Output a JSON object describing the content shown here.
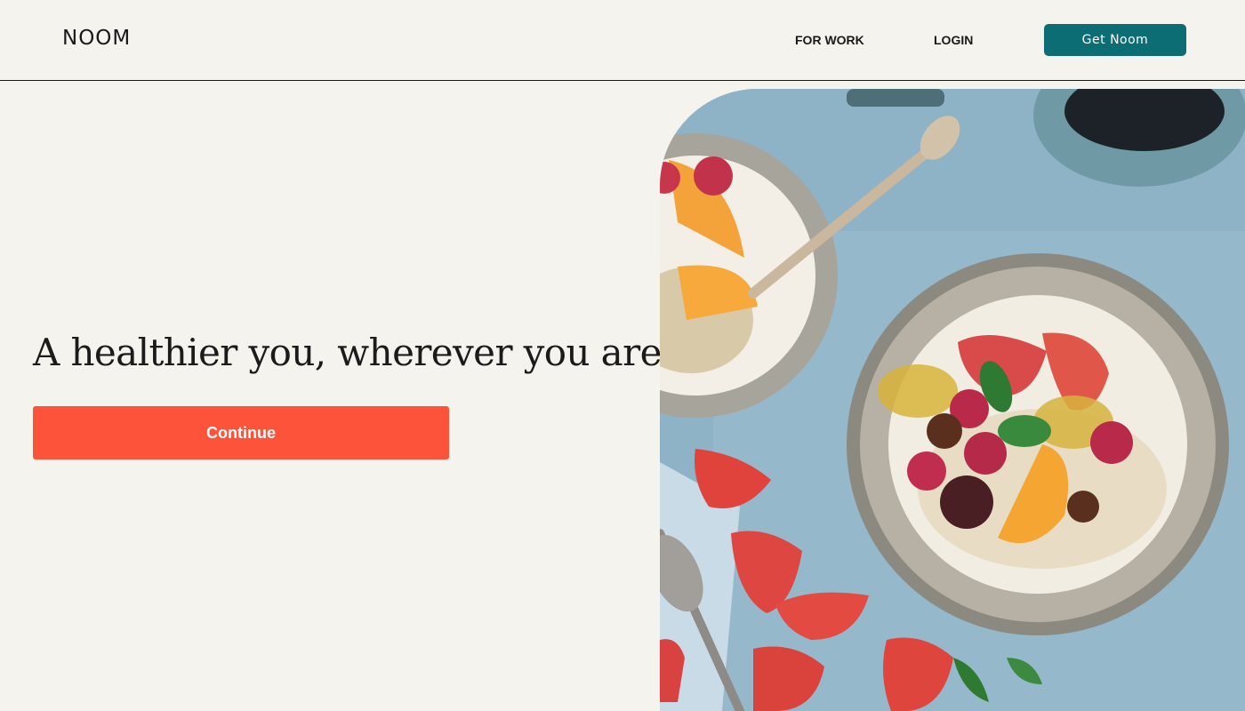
{
  "header": {
    "logo": "NOOM",
    "nav": {
      "for_work": "FOR WORK",
      "login": "LOGIN"
    },
    "cta_label": "Get Noom"
  },
  "hero": {
    "headline": "A healthier you, wherever you are.",
    "continue_label": "Continue",
    "image_description_icon": "breakfast-bowl-image"
  },
  "colors": {
    "background": "#f5f3ee",
    "brand_teal": "#0d6d74",
    "accent_orange": "#fd533b",
    "text_dark": "#1b1b1b"
  }
}
